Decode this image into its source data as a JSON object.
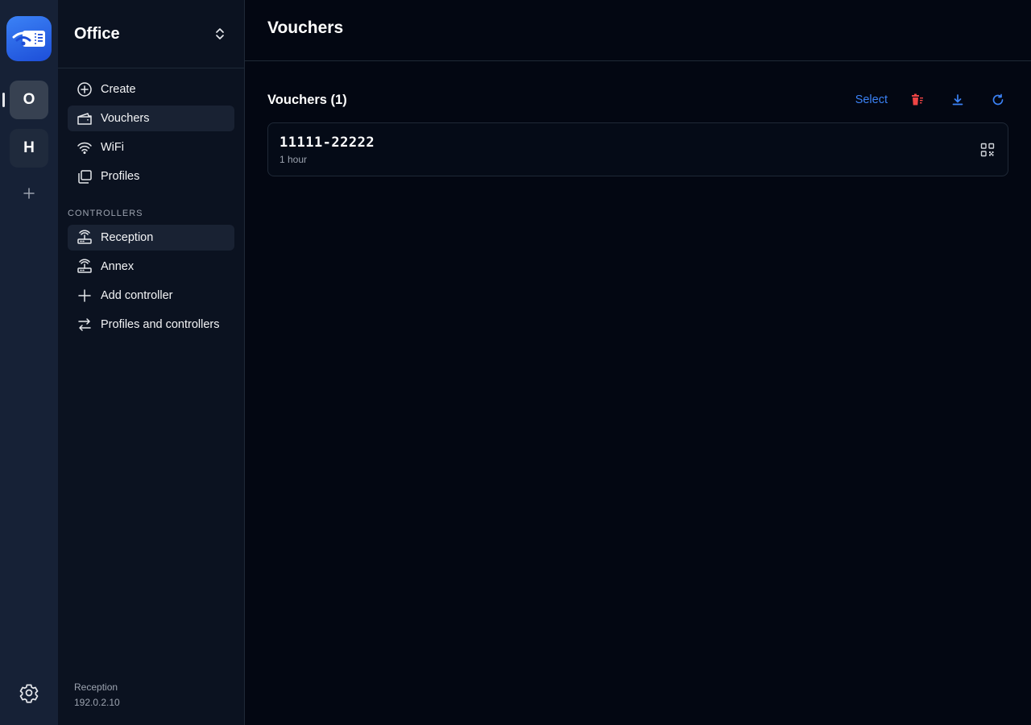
{
  "colors": {
    "accent": "#3b82f6",
    "danger": "#ef4444",
    "rail_bg": "#162136",
    "sidebar_bg": "#0b1220",
    "main_bg": "#030712"
  },
  "rail": {
    "logo_icon": "wifi-ticket-icon",
    "workspaces": [
      {
        "letter": "O",
        "active": true
      },
      {
        "letter": "H",
        "active": false
      }
    ],
    "add_icon": "plus-icon",
    "settings_icon": "gear-icon"
  },
  "sidebar": {
    "title": "Office",
    "switch_icon": "chevron-up-down-icon",
    "nav": [
      {
        "label": "Create",
        "icon": "plus-circle-icon"
      },
      {
        "label": "Vouchers",
        "icon": "ticket-icon",
        "active": true
      },
      {
        "label": "WiFi",
        "icon": "wifi-icon"
      },
      {
        "label": "Profiles",
        "icon": "profiles-icon"
      }
    ],
    "controllers_label": "CONTROLLERS",
    "controllers": [
      {
        "label": "Reception",
        "icon": "router-icon",
        "active": true
      },
      {
        "label": "Annex",
        "icon": "router-icon"
      },
      {
        "label": "Add controller",
        "icon": "plus-icon"
      },
      {
        "label": "Profiles and controllers",
        "icon": "arrows-right-left-icon"
      }
    ],
    "footer": {
      "name": "Reception",
      "ip": "192.0.2.10"
    }
  },
  "main": {
    "title": "Vouchers",
    "section_title": "Vouchers (1)",
    "actions": {
      "select_label": "Select",
      "delete_icon": "trash-icon",
      "download_icon": "download-icon",
      "refresh_icon": "refresh-icon"
    },
    "vouchers": [
      {
        "code": "11111-22222",
        "duration": "1 hour",
        "icon": "qr-code-icon"
      }
    ]
  }
}
